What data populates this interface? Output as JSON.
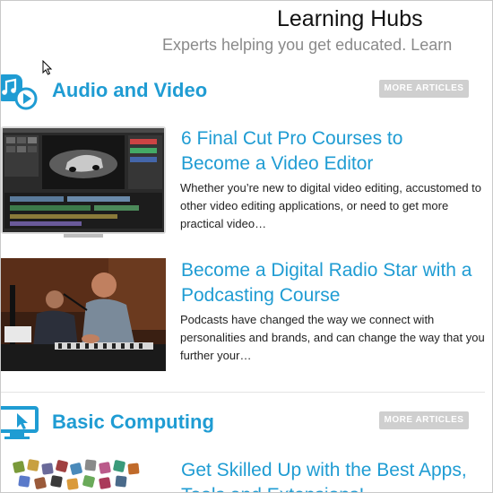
{
  "header": {
    "title": "Learning Hubs",
    "subtitle": "Experts helping you get educated. Learn"
  },
  "sections": [
    {
      "title": "Audio and Video",
      "icon": "music-video-icon",
      "more_label": "MORE ARTICLES",
      "articles": [
        {
          "title": "6 Final Cut Pro Courses to Become a Video Editor",
          "desc": "Whether you’re new to digital video editing, accustomed to other video editing applications, or need to get more practical video…",
          "thumb": "video-editor-screenshot"
        },
        {
          "title": "Become a Digital Radio Star with a Podcasting Course",
          "desc": "Podcasts have changed the way we connect with personalities and brands, and can change the way that you further your…",
          "thumb": "podcast-recording-photo"
        }
      ]
    },
    {
      "title": "Basic Computing",
      "icon": "monitor-cursor-icon",
      "more_label": "MORE ARTICLES",
      "articles": [
        {
          "title": "Get Skilled Up with the Best Apps, Tools and Extensions!",
          "thumb": "app-icons-collage"
        }
      ]
    }
  ],
  "colors": {
    "accent": "#1f9cd3",
    "button_bg": "#cfcfcf",
    "subtitle": "#8a8a8a"
  }
}
